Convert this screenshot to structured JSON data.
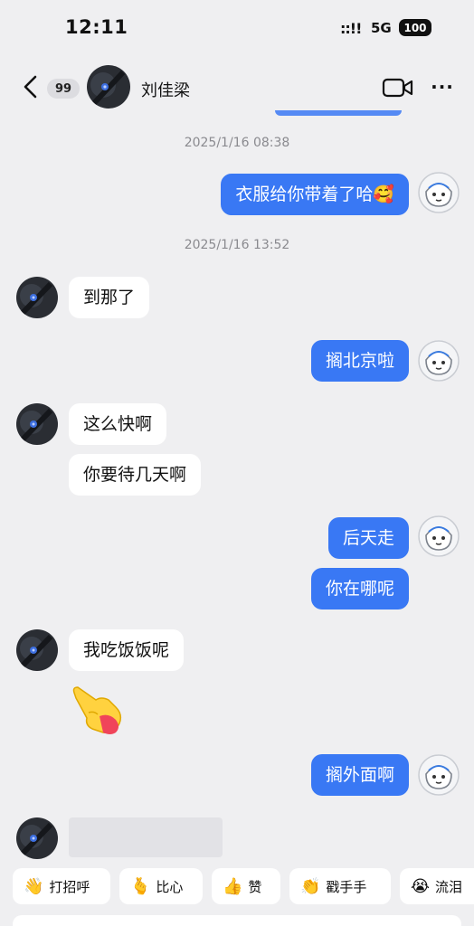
{
  "status_bar": {
    "time": "12:11",
    "signal": "::!!",
    "network": "5G",
    "battery": "100"
  },
  "nav": {
    "unread_count": "99",
    "contact_name": "刘佳梁"
  },
  "messages": [
    {
      "type": "timestamp",
      "text": "2025/1/16 08:38"
    },
    {
      "type": "out",
      "text": "衣服给你带着了哈🥰"
    },
    {
      "type": "timestamp",
      "text": "2025/1/16 13:52"
    },
    {
      "type": "in",
      "text": "到那了"
    },
    {
      "type": "out",
      "text": "搁北京啦"
    },
    {
      "type": "in",
      "text": "这么快啊"
    },
    {
      "type": "in",
      "text": "你要待几天啊"
    },
    {
      "type": "out",
      "text": "后天走"
    },
    {
      "type": "out",
      "text": "你在哪呢"
    },
    {
      "type": "in",
      "text": "我吃饭饭呢"
    },
    {
      "type": "in_sticker",
      "emoji": "👉"
    },
    {
      "type": "out",
      "text": "搁外面啊"
    }
  ],
  "quick_replies": [
    {
      "emoji": "👋",
      "label": "打招呼"
    },
    {
      "emoji": "🫰",
      "label": "比心"
    },
    {
      "emoji": "👍",
      "label": "赞"
    },
    {
      "emoji": "👏",
      "label": "戳手手"
    },
    {
      "emoji": "😭",
      "label": "流泪"
    }
  ],
  "colors": {
    "background": "#efeff1",
    "outgoing_bubble": "#3978f4",
    "incoming_bubble": "#ffffff"
  }
}
